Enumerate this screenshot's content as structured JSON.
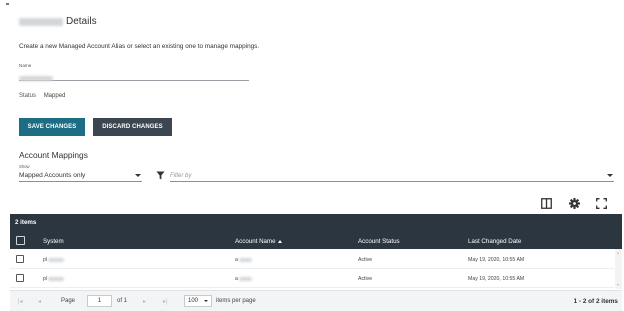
{
  "header": {
    "title_suffix": "Details",
    "description": "Create a new Managed Account Alias or select an existing one to manage mappings."
  },
  "form": {
    "name_label": "Name",
    "status_label": "Status",
    "status_value": "Mapped"
  },
  "actions": {
    "save_label": "SAVE CHANGES",
    "discard_label": "DISCARD CHANGES"
  },
  "mappings": {
    "section_title": "Account Mappings",
    "show_label": "Show",
    "show_value": "Mapped Accounts only",
    "filter_placeholder": "Filter by"
  },
  "toolbar": {
    "icons": [
      "columns-icon",
      "gear-icon",
      "fullscreen-icon"
    ]
  },
  "grid": {
    "items_count": "2 items",
    "columns": {
      "system": "System",
      "account_name": "Account Name",
      "account_status": "Account Status",
      "last_changed": "Last Changed Date"
    },
    "rows": [
      {
        "system_prefix": "pl",
        "account_prefix": "a",
        "status": "Active",
        "last_changed": "May 19, 2020, 10:55 AM"
      },
      {
        "system_prefix": "pl",
        "account_prefix": "a",
        "status": "Active",
        "last_changed": "May 19, 2020, 10:55 AM"
      }
    ]
  },
  "pager": {
    "page_label": "Page",
    "page_value": "1",
    "of_label": "of 1",
    "page_size": "100",
    "items_per_page_label": "items per page",
    "range_label": "1 - 2 of 2 items"
  },
  "colors": {
    "primary_button": "#1d6e85",
    "secondary_button": "#3c4650",
    "grid_header": "#2b3641"
  }
}
